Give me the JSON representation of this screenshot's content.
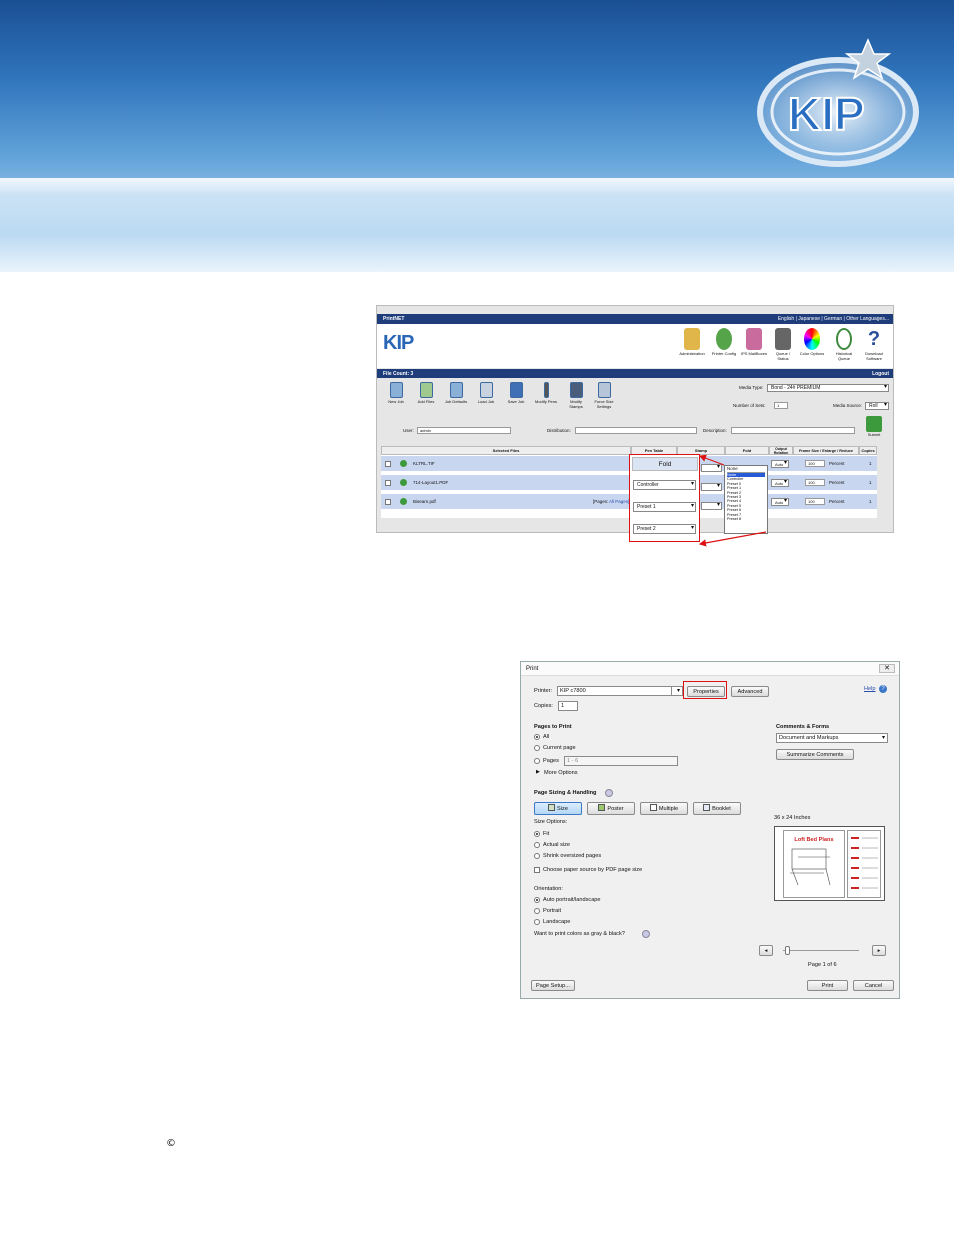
{
  "header": {
    "brand": "KIP"
  },
  "printnet": {
    "app_title": "PrintNET",
    "languages": "English | Japanese | German | Other Languages...",
    "logo_text": "KIP",
    "top_icons": [
      {
        "label": "Administration"
      },
      {
        "label": "Printer Config"
      },
      {
        "label": "IPS MailBoxes"
      },
      {
        "label": "Queue / Status"
      },
      {
        "label": "Color Options"
      },
      {
        "label": "Historical Queue"
      },
      {
        "label": "Download Software"
      }
    ],
    "file_count": "File Count: 3",
    "logout": "Logout",
    "toolbar": [
      {
        "label": "New Job"
      },
      {
        "label": "Add Files"
      },
      {
        "label": "Job Defaults"
      },
      {
        "label": "Load Job"
      },
      {
        "label": "Save Job"
      },
      {
        "label": "Modify Pens"
      },
      {
        "label": "Modify Stamps"
      },
      {
        "label": "Force Size Settings"
      }
    ],
    "media_type_label": "Media Type:",
    "media_type_value": "Bond - 24# PREMIUM",
    "sets_label": "Number of Sets:",
    "sets_value": "1",
    "media_source_label": "Media Source:",
    "media_source_value": "Roll",
    "user_label": "User:",
    "user_value": "admin",
    "distribution_label": "Distribution:",
    "description_label": "Description:",
    "submit_label": "Submit",
    "columns": [
      "Selected Files",
      "Pen Table",
      "Stamp",
      "Fold",
      "Output Rotation",
      "Frame Size / Enlarge / Reduce",
      "Copies"
    ],
    "rows": [
      {
        "name": "KLTRL.TIF",
        "rotation": "Auto",
        "scale": "100",
        "unit": "Percent",
        "copies": "1"
      },
      {
        "name": "714-Layout1.PDF",
        "rotation": "Auto",
        "scale": "100",
        "unit": "Percent",
        "copies": "1"
      },
      {
        "name": "Bisearn.pdf",
        "pages_label": "[Pages:",
        "pages_value": "All Pages]",
        "rotation": "Auto",
        "scale": "100",
        "unit": "Percent",
        "copies": "1"
      }
    ],
    "fold_header": "Fold",
    "fold_options_box": [
      "Controller",
      "Preset 1",
      "Preset 2"
    ],
    "fold_dropdown_selected": "None",
    "fold_dropdown_items": [
      "None",
      "Controller",
      "Preset 0",
      "Preset 1",
      "Preset 2",
      "Preset 3",
      "Preset 4",
      "Preset 5",
      "Preset 6",
      "Preset 7",
      "Preset 8"
    ]
  },
  "print_dialog": {
    "title": "Print",
    "printer_label": "Printer:",
    "printer_value": "KIP c7800",
    "properties": "Properties",
    "advanced": "Advanced",
    "help": "Help",
    "copies_label": "Copies:",
    "copies_value": "1",
    "pages_to_print": "Pages to Print",
    "opt_all": "All",
    "opt_current": "Current page",
    "opt_pages": "Pages",
    "pages_range": "1 - 6",
    "more_options": "More Options",
    "comments_forms": "Comments & Forms",
    "comments_value": "Document and Markups",
    "summarize": "Summarize Comments",
    "sizing_title": "Page Sizing & Handling",
    "tab_size": "Size",
    "tab_poster": "Poster",
    "tab_multiple": "Multiple",
    "tab_booklet": "Booklet",
    "size_options": "Size Options:",
    "opt_fit": "Fit",
    "opt_actual": "Actual size",
    "opt_shrink": "Shrink oversized pages",
    "opt_choose_source": "Choose paper source by PDF page size",
    "orientation": "Orientation:",
    "opt_auto": "Auto portrait/landscape",
    "opt_portrait": "Portrait",
    "opt_landscape": "Landscape",
    "gray_question": "Want to print colors as gray & black?",
    "preview_size": "36 x 24 Inches",
    "preview_heading1": "Loft Bed Plans",
    "page_indicator": "Page 1 of 6",
    "page_setup": "Page Setup...",
    "print": "Print",
    "cancel": "Cancel"
  },
  "footer": {
    "copyright_symbol": "©"
  }
}
